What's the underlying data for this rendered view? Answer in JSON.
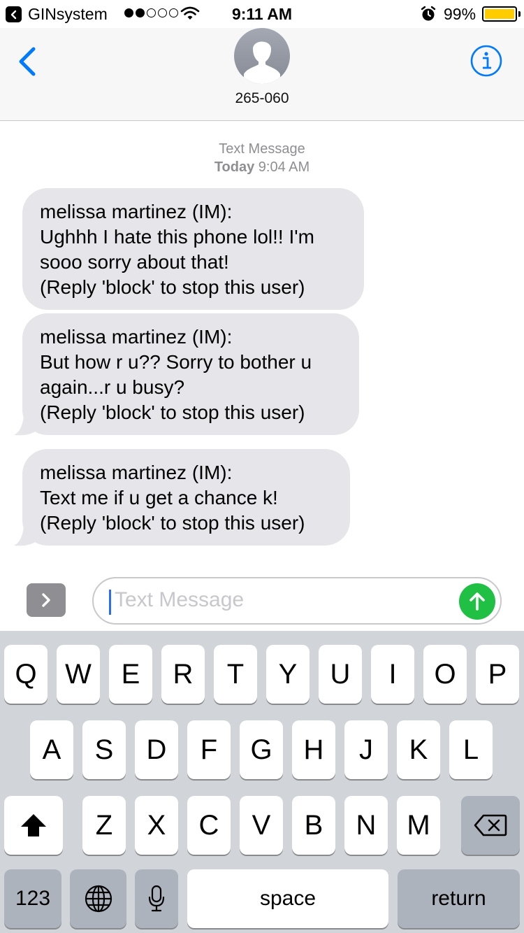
{
  "status_bar": {
    "back_app": "GINsystem",
    "time": "9:11 AM",
    "battery_percent": "99%",
    "battery_level": 0.99,
    "signal_bars_filled": 2,
    "signal_bars_total": 5
  },
  "header": {
    "contact": "265-060"
  },
  "conversation": {
    "timestamp_label": "Text Message",
    "timestamp_day": "Today",
    "timestamp_time": "9:04 AM",
    "messages": [
      {
        "text": "melissa martinez (IM):\nUghhh I hate this phone lol!! I'm\nsooo sorry about that!\n(Reply 'block' to stop this user)"
      },
      {
        "text": "melissa martinez (IM):\nBut how r u?? Sorry to bother u\nagain...r u busy?\n(Reply 'block' to stop this user)"
      },
      {
        "text": "melissa martinez (IM):\nText me if u get a chance k!\n(Reply 'block' to stop this user)"
      }
    ]
  },
  "composer": {
    "placeholder": "Text Message"
  },
  "keyboard": {
    "row1": [
      "Q",
      "W",
      "E",
      "R",
      "T",
      "Y",
      "U",
      "I",
      "O",
      "P"
    ],
    "row2": [
      "A",
      "S",
      "D",
      "F",
      "G",
      "H",
      "J",
      "K",
      "L"
    ],
    "row3": [
      "Z",
      "X",
      "C",
      "V",
      "B",
      "N",
      "M"
    ],
    "numbers_key": "123",
    "space_key": "space",
    "return_key": "return"
  },
  "colors": {
    "accent": "#007aff",
    "send_button": "#1fc044",
    "incoming_bubble": "#e5e5ea",
    "battery": "#ffcc00"
  },
  "icons": [
    "back-app-icon",
    "wifi-icon",
    "alarm-icon",
    "battery-icon",
    "back-chevron-icon",
    "contact-avatar-icon",
    "info-icon",
    "app-drawer-icon",
    "send-arrow-icon",
    "shift-icon",
    "delete-icon",
    "globe-icon",
    "microphone-icon"
  ]
}
